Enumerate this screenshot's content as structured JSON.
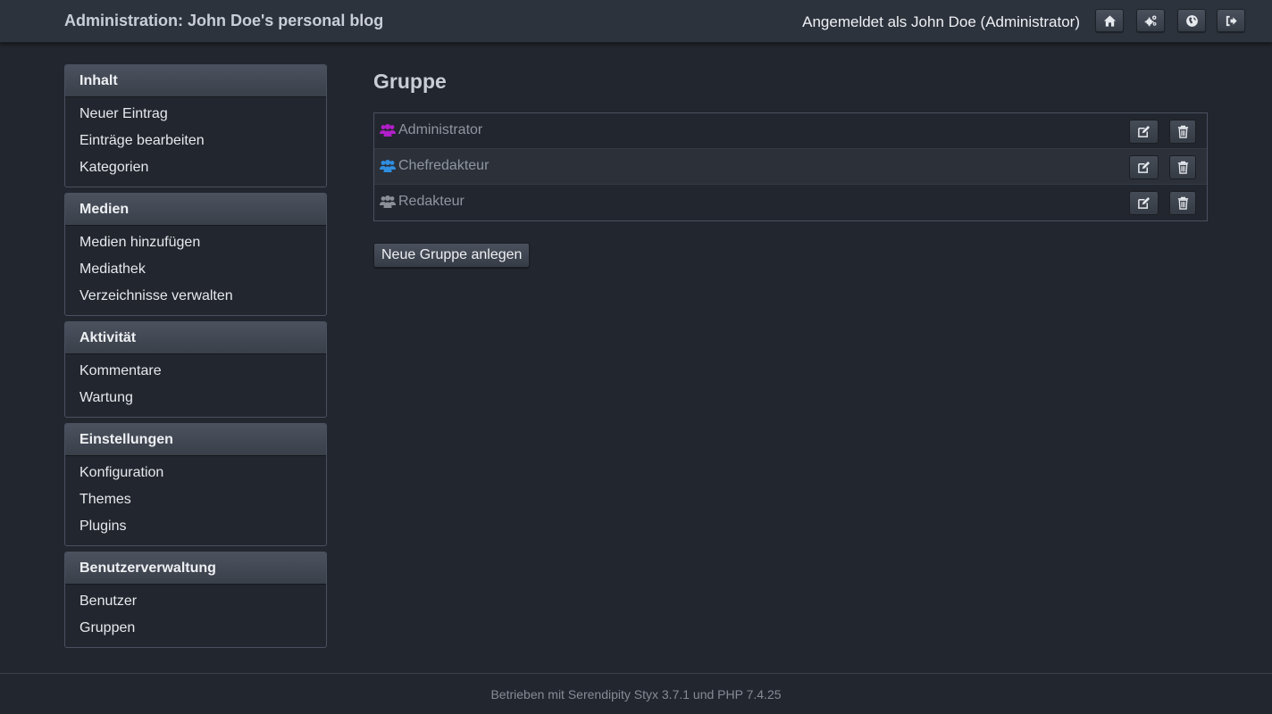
{
  "header": {
    "title": "Administration: John Doe's personal blog",
    "login_text": "Angemeldet als John Doe (Administrator)",
    "buttons": [
      {
        "icon": "home-icon"
      },
      {
        "icon": "cogs-icon"
      },
      {
        "icon": "globe-icon"
      },
      {
        "icon": "logout-icon"
      }
    ]
  },
  "sidebar": {
    "sections": [
      {
        "title": "Inhalt",
        "items": [
          "Neuer Eintrag",
          "Einträge bearbeiten",
          "Kategorien"
        ]
      },
      {
        "title": "Medien",
        "items": [
          "Medien hinzufügen",
          "Mediathek",
          "Verzeichnisse verwalten"
        ]
      },
      {
        "title": "Aktivität",
        "items": [
          "Kommentare",
          "Wartung"
        ]
      },
      {
        "title": "Einstellungen",
        "items": [
          "Konfiguration",
          "Themes",
          "Plugins"
        ]
      },
      {
        "title": "Benutzerverwaltung",
        "items": [
          "Benutzer",
          "Gruppen"
        ]
      }
    ]
  },
  "main": {
    "title": "Gruppe",
    "groups": [
      {
        "name": "Administrator",
        "icon_color": "#b21ec8"
      },
      {
        "name": "Chefredakteur",
        "icon_color": "#2f8ee0"
      },
      {
        "name": "Redakteur",
        "icon_color": "#8a8f98"
      }
    ],
    "new_group_label": "Neue Gruppe anlegen"
  },
  "footer": {
    "text": "Betrieben mit Serendipity Styx 3.7.1 und PHP 7.4.25"
  }
}
